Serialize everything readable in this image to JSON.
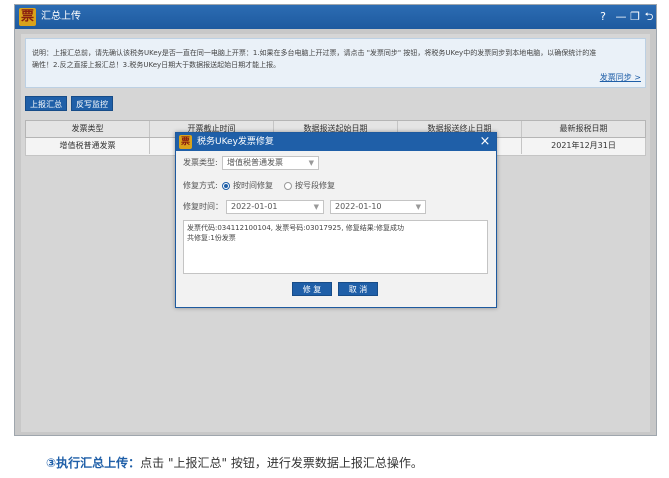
{
  "window": {
    "logo_char": "票",
    "title": "汇总上传",
    "controls": {
      "help": "?",
      "minimize": "—",
      "maximize": "❐",
      "back": "⮌"
    }
  },
  "notice": {
    "line1": "说明：上报汇总前，请先确认该税务UKey是否一直在同一电脑上开票：1.如果在多台电脑上开过票，请点击 \"发票同步\" 按钮，将税务UKey中的发票同步到本地电脑，以确保统计的准",
    "line2": "确性！2.反之直接上报汇总！3.税务UKey日期大于数据报送起始日期才能上报。",
    "sync_link": "发票同步 >"
  },
  "toolbar": {
    "report_summary": "上报汇总",
    "reverse_monitor": "反写监控"
  },
  "table": {
    "headers": [
      "发票类型",
      "开票截止时间",
      "数据报送起始日期",
      "数据报送终止日期",
      "最新报税日期"
    ],
    "rows": [
      [
        "增值税普通发票",
        "",
        "",
        "",
        "2021年12月31日"
      ]
    ]
  },
  "dialog": {
    "logo_char": "票",
    "title": "税务UKey发票修复",
    "close": "×",
    "invoice_type_label": "发票类型:",
    "invoice_type_value": "增值税普通发票",
    "repair_mode_label": "修复方式:",
    "repair_mode_options": [
      "按时间修复",
      "按号段修复"
    ],
    "repair_mode_selected": "按时间修复",
    "repair_time_label": "修复时间：",
    "start_date": "2022-01-01",
    "end_date": "2022-01-10",
    "result_line1": "发票代码:034112100104, 发票号码:03017925, 修复结果:修复成功",
    "result_line2": "共修复:1份发票",
    "repair_button": "修 复",
    "cancel_button": "取 消"
  },
  "caption": {
    "step": "③执行汇总上传：",
    "text": "点击 \"上报汇总\" 按钮，进行发票数据上报汇总操作。"
  },
  "colors": {
    "titlebar": "#1f5fa8",
    "button": "#1f5fa8",
    "logo": "#d9a21b"
  }
}
